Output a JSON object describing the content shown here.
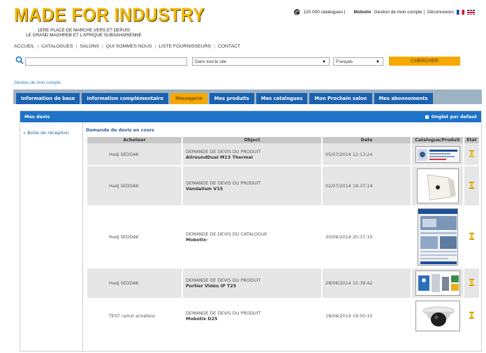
{
  "brand": {
    "logo": "MADE FOR INDUSTRY",
    "tagline_line1": "1ERE PLACE DE MARCHE VERS ET DEPUIS",
    "tagline_line2": "LE GRAND MAGHREB ET L'AFRIQUE SUBSAHARIENNE"
  },
  "toplinks": {
    "catalogues": "120 000 catalogues |",
    "user": "Mobotix",
    "account": "Gestion de mon compte |",
    "logout": "Déconnexion"
  },
  "mainnav": {
    "items": [
      "ACCUEIL",
      "CATALOGUES",
      "SALONS",
      "QUI SOMMES NOUS",
      "LISTE FOURNISSEURS",
      "CONTACT"
    ],
    "separator": "|"
  },
  "search": {
    "query": "",
    "scope": "Dans tout le site",
    "language": "Français",
    "button": "CHERCHER"
  },
  "breadcrumb": "Gestion de mon compte",
  "tabs": [
    {
      "label": "Information de base",
      "active": false
    },
    {
      "label": "Information complémentaire",
      "active": false
    },
    {
      "label": "Messagerie",
      "active": true
    },
    {
      "label": "Mes produits",
      "active": false
    },
    {
      "label": "Mes catalogues",
      "active": false
    },
    {
      "label": "Mon Prochain salon",
      "active": false
    },
    {
      "label": "Mes abonnements",
      "active": false
    }
  ],
  "panel": {
    "title": "Mes devis",
    "right_label": "Onglet par defaut",
    "inbox_label": "Boite de réception",
    "pending_title": "Demande de devis en cours",
    "columns": [
      "Acheteur",
      "Object",
      "Date",
      "Catalogue/Produit",
      "Etat"
    ],
    "rows": [
      {
        "buyer": "Hadj SEDDAK",
        "subject": "DEMANDE DE DEVIS DU PRODUIT",
        "product": "AllroundDual M13 Thermal",
        "date": "05/07/2014 12:13:24",
        "thumb": "product-thumbnail"
      },
      {
        "buyer": "Hadj SEDDAK",
        "subject": "DEMANDE DE DEVIS DU PRODUIT",
        "product": "Vandalism V15",
        "date": "02/07/2014 19:37:14",
        "thumb": "product-thumbnail"
      },
      {
        "buyer": "Hadj SEDDAK",
        "subject": "DEMANDE DE DEVIS DU CATALOGUE",
        "product": "Mobotix-",
        "date": "30/06/2014 20:37:10",
        "thumb": "catalogue-thumbnail"
      },
      {
        "buyer": "Hadj SEDDAK",
        "subject": "DEMANDE DE DEVIS DU PRODUIT",
        "product": "Portier Vidéo IP T25",
        "date": "28/06/2014 15:39:42",
        "thumb": "product-thumbnail"
      },
      {
        "buyer": "TEST ramzi acheteur",
        "subject": "DEMANDE DE DEVIS DU PRODUIT",
        "product": "Mobotix D25",
        "date": "18/06/2014 19:50:15",
        "thumb": "product-thumbnail"
      }
    ]
  },
  "colors": {
    "tab_blue": "#1a62b0",
    "tab_active": "#f5a800",
    "panel_header": "#1e73c8",
    "logo_yellow": "#f2b70e",
    "button_orange": "#f5a800"
  }
}
